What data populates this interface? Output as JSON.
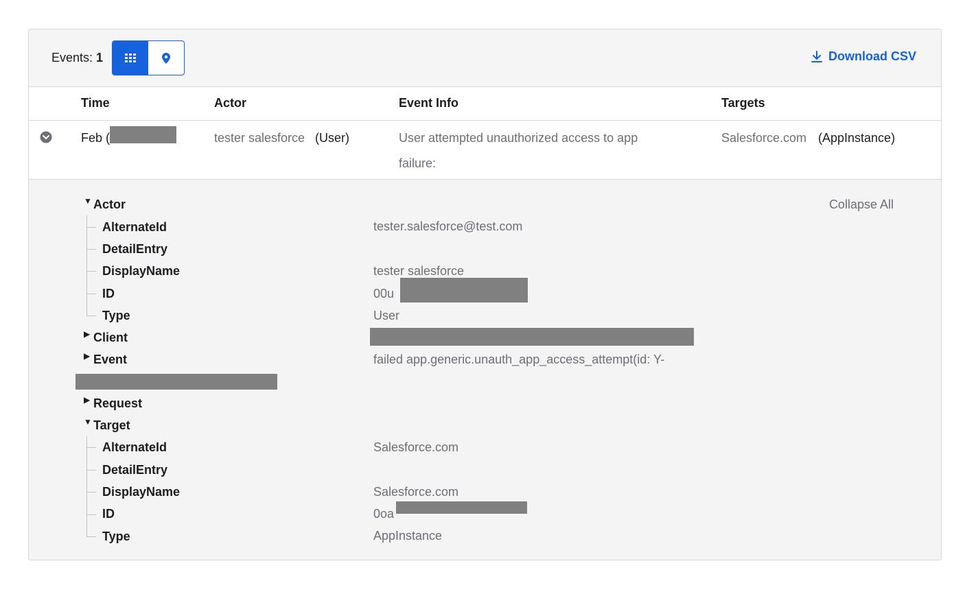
{
  "toolbar": {
    "events_label": "Events:",
    "events_count": "1",
    "grid_view_icon": "grid-icon",
    "map_view_icon": "map-pin-icon",
    "download_label": "Download CSV",
    "download_icon": "download-icon",
    "accent": "#1662dd"
  },
  "table": {
    "headers": {
      "time": "Time",
      "actor": "Actor",
      "event_info": "Event Info",
      "targets": "Targets"
    },
    "row": {
      "time": "Feb (",
      "actor_name": "tester salesforce",
      "actor_type": "(User)",
      "event_info": "User attempted unauthorized access to app",
      "event_outcome": "failure:",
      "target_name": "Salesforce.com",
      "target_type": "(AppInstance)"
    }
  },
  "detail": {
    "collapse_all": "Collapse All",
    "actor": {
      "label": "Actor",
      "alternate_id_label": "AlternateId",
      "alternate_id": "tester.salesforce@test.com",
      "detail_entry_label": "DetailEntry",
      "display_name_label": "DisplayName",
      "display_name": "tester salesforce",
      "id_label": "ID",
      "id": "00u",
      "type_label": "Type",
      "type": "User"
    },
    "client": {
      "label": "Client"
    },
    "event": {
      "label": "Event",
      "value": "failed app.generic.unauth_app_access_attempt(id: Y-"
    },
    "request": {
      "label": "Request"
    },
    "target": {
      "label": "Target",
      "alternate_id_label": "AlternateId",
      "alternate_id": "Salesforce.com",
      "detail_entry_label": "DetailEntry",
      "display_name_label": "DisplayName",
      "display_name": "Salesforce.com",
      "id_label": "ID",
      "id": "0oa",
      "type_label": "Type",
      "type": "AppInstance"
    }
  }
}
